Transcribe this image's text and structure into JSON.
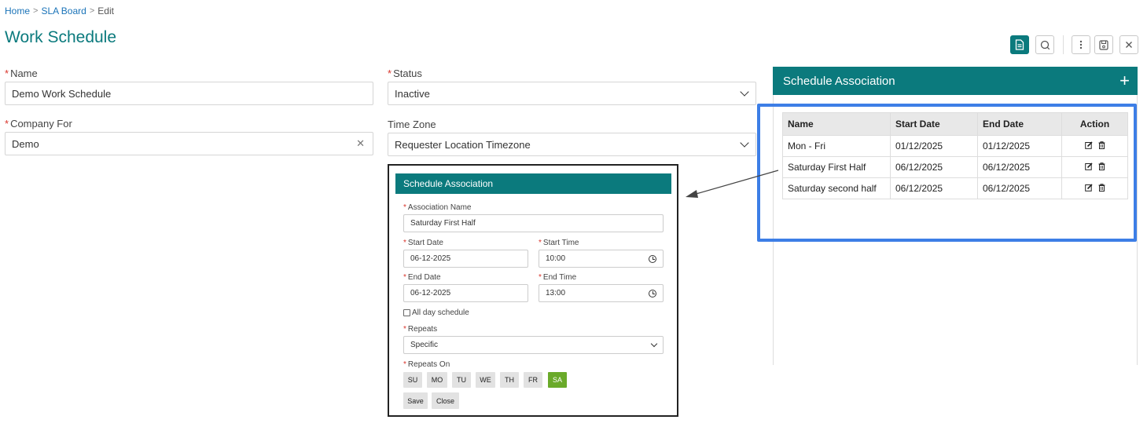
{
  "breadcrumb": {
    "home": "Home",
    "sla_board": "SLA Board",
    "current": "Edit",
    "separator": ">"
  },
  "page_title": "Work Schedule",
  "form": {
    "name_label": "Name",
    "name_value": "Demo Work Schedule",
    "status_label": "Status",
    "status_value": "Inactive",
    "company_label": "Company For",
    "company_value": "Demo",
    "timezone_label": "Time Zone",
    "timezone_value": "Requester Location Timezone",
    "required_mark": "*"
  },
  "schedule_panel": {
    "title": "Schedule Association",
    "add_symbol": "+",
    "columns": [
      "Name",
      "Start Date",
      "End Date",
      "Action"
    ],
    "rows": [
      {
        "name": "Mon - Fri",
        "start": "01/12/2025",
        "end": "01/12/2025"
      },
      {
        "name": "Saturday First Half",
        "start": "06/12/2025",
        "end": "06/12/2025"
      },
      {
        "name": "Saturday second half",
        "start": "06/12/2025",
        "end": "06/12/2025"
      }
    ]
  },
  "dialog": {
    "title": "Schedule Association",
    "association_name_label": "Association Name",
    "association_name_value": "Saturday First Half",
    "start_date_label": "Start Date",
    "start_date_value": "06-12-2025",
    "start_time_label": "Start Time",
    "start_time_value": "10:00",
    "end_date_label": "End Date",
    "end_date_value": "06-12-2025",
    "end_time_label": "End Time",
    "end_time_value": "13:00",
    "all_day_label": "All day schedule",
    "repeats_label": "Repeats",
    "repeats_value": "Specific",
    "repeats_on_label": "Repeats On",
    "days": [
      "SU",
      "MO",
      "TU",
      "WE",
      "TH",
      "FR",
      "SA"
    ],
    "selected_day": "SA",
    "save_label": "Save",
    "close_label": "Close"
  },
  "colors": {
    "accent": "#0b7a7d",
    "highlight": "#3d7ee6",
    "day_selected": "#6aaa2a",
    "required": "#d9342b"
  },
  "icons": [
    "document-icon",
    "search-icon",
    "more-vertical-icon",
    "save-icon",
    "close-icon",
    "plus-icon",
    "edit-icon",
    "trash-icon",
    "clock-icon",
    "chevron-down-icon",
    "clear-icon"
  ]
}
